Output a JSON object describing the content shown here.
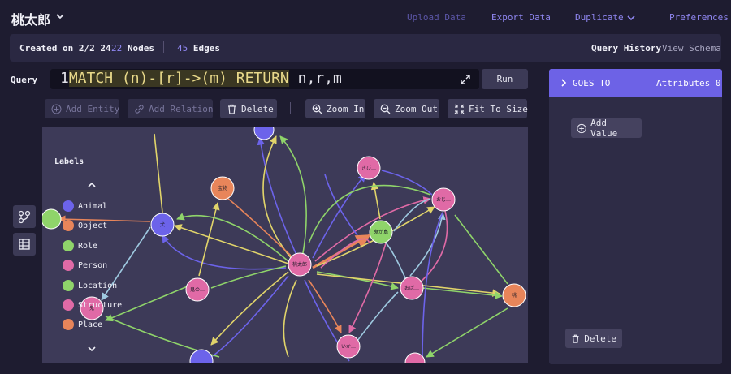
{
  "header": {
    "title": "桃太郎",
    "upload_label": "Upload Data",
    "export_label": "Export Data",
    "duplicate_label": "Duplicate",
    "preferences_label": "Preferences"
  },
  "stats": {
    "created_label": "Created on 2/2 24",
    "nodes_count": "22",
    "nodes_label": "Nodes",
    "edges_count": "45",
    "edges_label": "Edges",
    "query_history_label": "Query History",
    "view_schema_label": "View Schema"
  },
  "query": {
    "label": "Query",
    "line_number": "1",
    "text_prefix": "MATCH (n)-[r]->(m) RETURN",
    "text_suffix": " n,r,m",
    "run_label": "Run"
  },
  "toolbar": {
    "add_entity": "Add Entity",
    "add_relation": "Add Relation",
    "delete": "Delete",
    "zoom_in": "Zoom In",
    "zoom_out": "Zoom Out",
    "fit": "Fit To Size"
  },
  "legend": {
    "title": "Labels",
    "items": [
      {
        "label": "Animal",
        "color": "#6c63ea"
      },
      {
        "label": "Object",
        "color": "#e8855a"
      },
      {
        "label": "Role",
        "color": "#8fd46a"
      },
      {
        "label": "Person",
        "color": "#e06aa6"
      },
      {
        "label": "Location",
        "color": "#8fd46a"
      },
      {
        "label": "Structure",
        "color": "#e06aa6"
      },
      {
        "label": "Place",
        "color": "#e8855a"
      }
    ]
  },
  "graph": {
    "node_labels": [
      "犬",
      "宝物",
      "桃太郎",
      "きび…",
      "おじ…",
      "鬼が島",
      "おば…",
      "鬼の…",
      "いか…",
      "桃",
      "鬼"
    ]
  },
  "panel": {
    "relation_type": "GOES_TO",
    "attributes_label": "Attributes 0",
    "add_value_label": "Add Value",
    "delete_label": "Delete"
  },
  "colors": {
    "accent": "#6d62e6",
    "background": "#1e1c30",
    "canvas": "#3d3a58"
  }
}
